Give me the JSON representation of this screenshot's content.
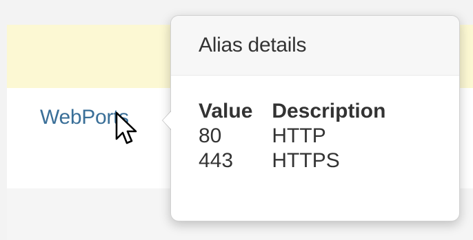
{
  "alias": {
    "link_label": "WebPorts"
  },
  "popover": {
    "title": "Alias details",
    "columns": [
      "Value",
      "Description"
    ],
    "rows": [
      {
        "value": "80",
        "description": "HTTP"
      },
      {
        "value": "443",
        "description": "HTTPS"
      }
    ]
  },
  "colors": {
    "link": "#3a6f98",
    "highlight_row": "#fcf8d3",
    "text": "#333333"
  }
}
